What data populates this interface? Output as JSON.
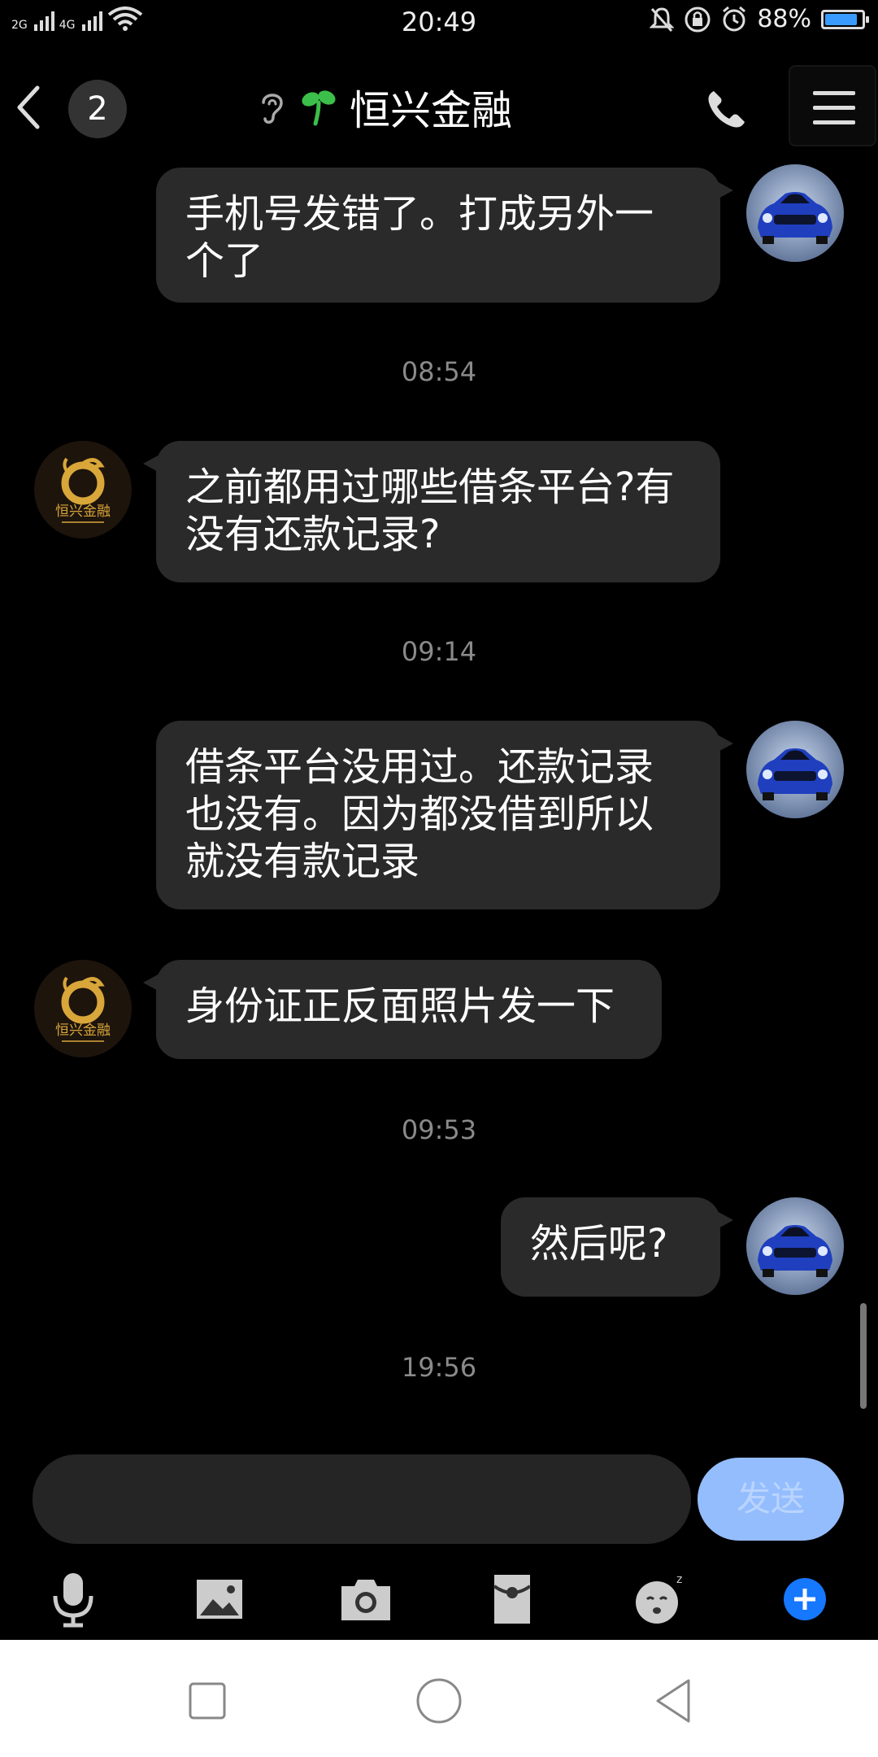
{
  "status_bar": {
    "network_1": "2G",
    "network_2": "4G",
    "time": "20:49",
    "battery": "88%",
    "battery_level": 0.88
  },
  "header": {
    "unread_count": "2",
    "title": "恒兴金融"
  },
  "messages": [
    {
      "type": "message",
      "side": "out",
      "text": "手机号发错了。打成另外一个了"
    },
    {
      "type": "time",
      "text": "08:54"
    },
    {
      "type": "message",
      "side": "in",
      "text": "之前都用过哪些借条平台?有没有还款记录?"
    },
    {
      "type": "time",
      "text": "09:14"
    },
    {
      "type": "message",
      "side": "out",
      "text": "借条平台没用过。还款记录也没有。因为都没借到所以就没有款记录"
    },
    {
      "type": "message",
      "side": "in",
      "text": "身份证正反面照片发一下"
    },
    {
      "type": "time",
      "text": "09:53"
    },
    {
      "type": "message",
      "side": "out",
      "text": "然后呢?"
    },
    {
      "type": "time",
      "text": "19:56"
    }
  ],
  "contact_avatar_text": "恒兴金融",
  "composer": {
    "placeholder": "",
    "send_label": "发送"
  },
  "colors": {
    "background": "#000000",
    "bubble": "#2a2a2a",
    "accent": "#1677ff",
    "send_disabled": "#94bdfd"
  }
}
